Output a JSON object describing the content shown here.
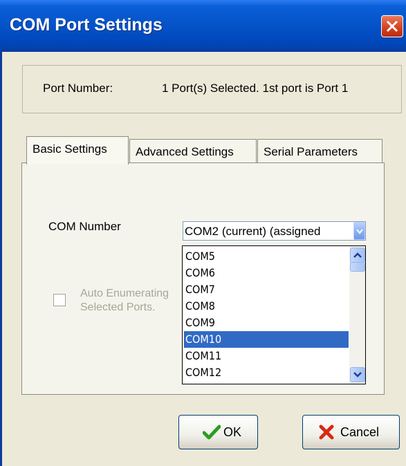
{
  "window": {
    "title": "COM Port Settings",
    "close_icon": "close-icon"
  },
  "port": {
    "label": "Port Number:",
    "value": "1 Port(s) Selected. 1st port is Port 1"
  },
  "tabs": [
    {
      "label": "Basic Settings",
      "active": true
    },
    {
      "label": "Advanced Settings",
      "active": false
    },
    {
      "label": "Serial Parameters",
      "active": false
    }
  ],
  "basic": {
    "com_label": "COM Number",
    "combo_value": "COM2 (current) (assigned",
    "list_items": [
      "COM5",
      "COM6",
      "COM7",
      "COM8",
      "COM9",
      "COM10",
      "COM11",
      "COM12"
    ],
    "selected_item": "COM10",
    "auto_line1": "Auto Enumerating",
    "auto_line2": "Selected Ports.",
    "auto_checked": false
  },
  "buttons": {
    "ok": "OK",
    "cancel": "Cancel"
  },
  "colors": {
    "titlebar": "#0552c8",
    "selection": "#316ac5",
    "dialog_bg": "#ece9d8",
    "ok_check": "#2a9d22",
    "cancel_x": "#d62a12"
  }
}
